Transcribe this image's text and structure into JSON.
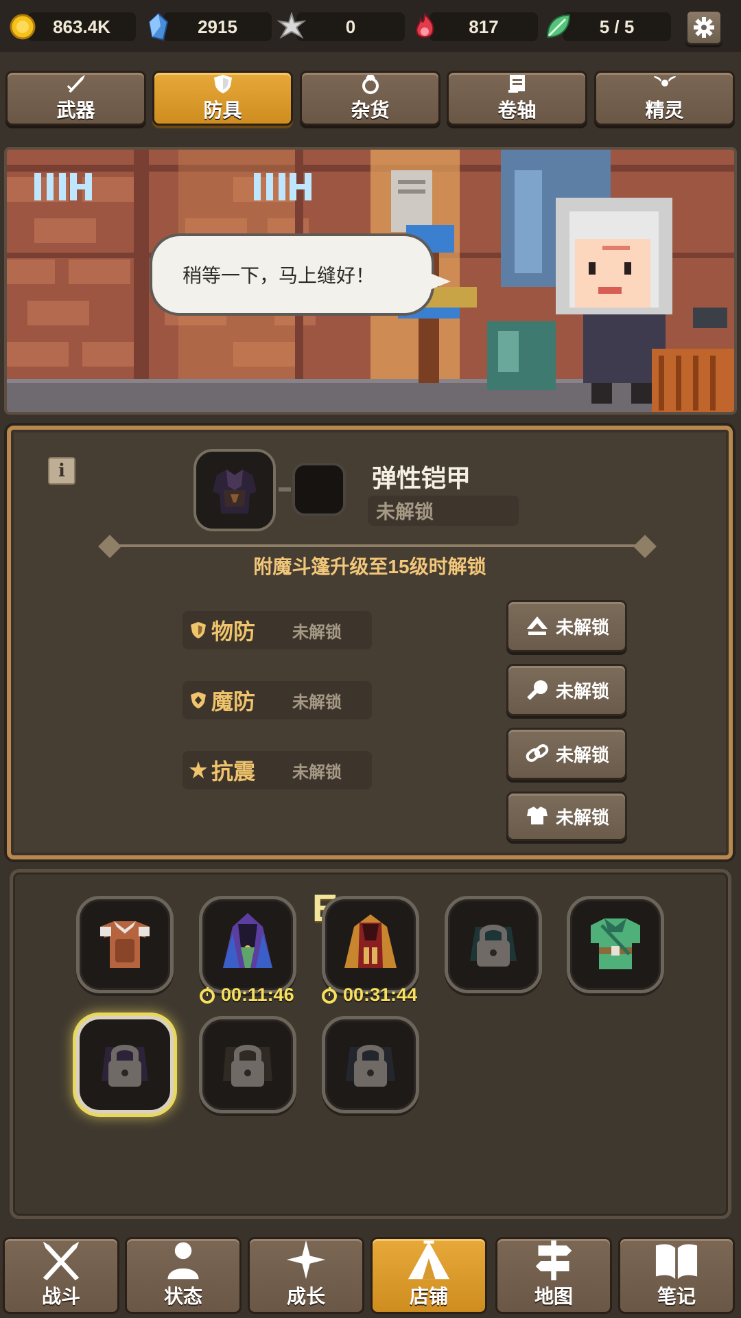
{
  "resources": [
    {
      "icon": "gold-coin-icon",
      "value": "863.4K"
    },
    {
      "icon": "blue-crystal-icon",
      "value": "2915"
    },
    {
      "icon": "silver-star-icon",
      "value": "0"
    },
    {
      "icon": "red-flame-icon",
      "value": "817"
    },
    {
      "icon": "green-leaf-icon",
      "value": "5 / 5"
    }
  ],
  "category_tabs": [
    {
      "label": "武器",
      "icon": "sword-icon",
      "active": false
    },
    {
      "label": "防具",
      "icon": "shield-icon",
      "active": true
    },
    {
      "label": "杂货",
      "icon": "ring-icon",
      "active": false
    },
    {
      "label": "卷轴",
      "icon": "scroll-icon",
      "active": false
    },
    {
      "label": "精灵",
      "icon": "wings-icon",
      "active": false
    }
  ],
  "scene": {
    "speech": "稍等一下，马上缝好！"
  },
  "detail": {
    "item_name": "弹性铠甲",
    "item_status": "未解锁",
    "unlock_condition": "附魔斗篷升级至15级时解锁",
    "stats": [
      {
        "label": "物防",
        "value": "未解锁",
        "icon": "physical-defense-icon"
      },
      {
        "label": "魔防",
        "value": "未解锁",
        "icon": "magic-defense-icon"
      },
      {
        "label": "抗震",
        "value": "未解锁",
        "icon": "stun-resist-icon"
      }
    ],
    "actions": [
      {
        "label": "未解锁",
        "icon": "upgrade-arrow-icon"
      },
      {
        "label": "未解锁",
        "icon": "hammer-icon"
      },
      {
        "label": "未解锁",
        "icon": "chain-link-icon"
      },
      {
        "label": "未解锁",
        "icon": "armor-icon"
      }
    ]
  },
  "inventory": {
    "grade_label": "E",
    "timers": [
      "00:11:46",
      "00:31:44"
    ]
  },
  "bottom_nav": [
    {
      "label": "战斗",
      "icon": "crossed-swords-icon",
      "active": false
    },
    {
      "label": "状态",
      "icon": "person-icon",
      "active": false
    },
    {
      "label": "成长",
      "icon": "sparkle-icon",
      "active": false
    },
    {
      "label": "店铺",
      "icon": "tent-icon",
      "active": true
    },
    {
      "label": "地图",
      "icon": "signpost-icon",
      "active": false
    },
    {
      "label": "笔记",
      "icon": "book-icon",
      "active": false
    }
  ],
  "colors": {
    "accent_gold": "#e7a93a",
    "panel_border": "#b9884f",
    "unlock_text": "#f2c77a",
    "timer_text": "#f6e05c"
  }
}
